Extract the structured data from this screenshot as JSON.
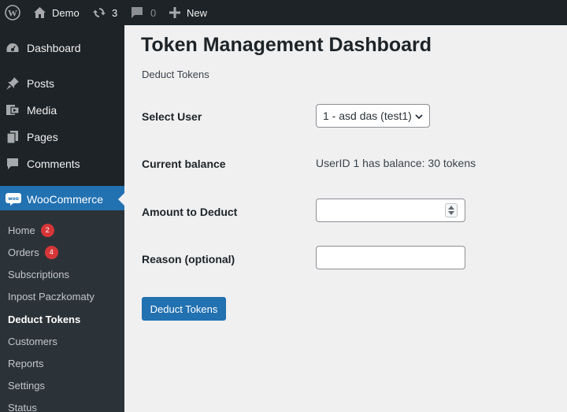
{
  "admin_bar": {
    "site_name": "Demo",
    "updates_count": "3",
    "comments_count": "0",
    "new_label": "New"
  },
  "sidebar": {
    "items": [
      {
        "label": "Dashboard",
        "icon": "dashboard-icon"
      },
      {
        "label": "Posts",
        "icon": "pin-icon"
      },
      {
        "label": "Media",
        "icon": "media-icon"
      },
      {
        "label": "Pages",
        "icon": "pages-icon"
      },
      {
        "label": "Comments",
        "icon": "comment-icon"
      },
      {
        "label": "WooCommerce",
        "icon": "woocommerce-icon"
      }
    ],
    "submenu": [
      {
        "label": "Home",
        "badge": "2"
      },
      {
        "label": "Orders",
        "badge": "4"
      },
      {
        "label": "Subscriptions"
      },
      {
        "label": "Inpost Paczkomaty"
      },
      {
        "label": "Deduct Tokens"
      },
      {
        "label": "Customers"
      },
      {
        "label": "Reports"
      },
      {
        "label": "Settings"
      },
      {
        "label": "Status"
      }
    ]
  },
  "main": {
    "title": "Token Management Dashboard",
    "subtitle": "Deduct Tokens",
    "select_user_label": "Select User",
    "selected_user": "1 - asd das (test1)",
    "current_balance_label": "Current balance",
    "current_balance_value": "UserID 1 has balance: 30 tokens",
    "amount_label": "Amount to Deduct",
    "amount_value": "",
    "reason_label": "Reason (optional)",
    "reason_value": "",
    "submit_label": "Deduct Tokens"
  },
  "colors": {
    "admin_dark": "#1d2327",
    "submenu_bg": "#2c3338",
    "accent": "#2271b1",
    "badge": "#d63638",
    "content_bg": "#f0f0f1"
  }
}
